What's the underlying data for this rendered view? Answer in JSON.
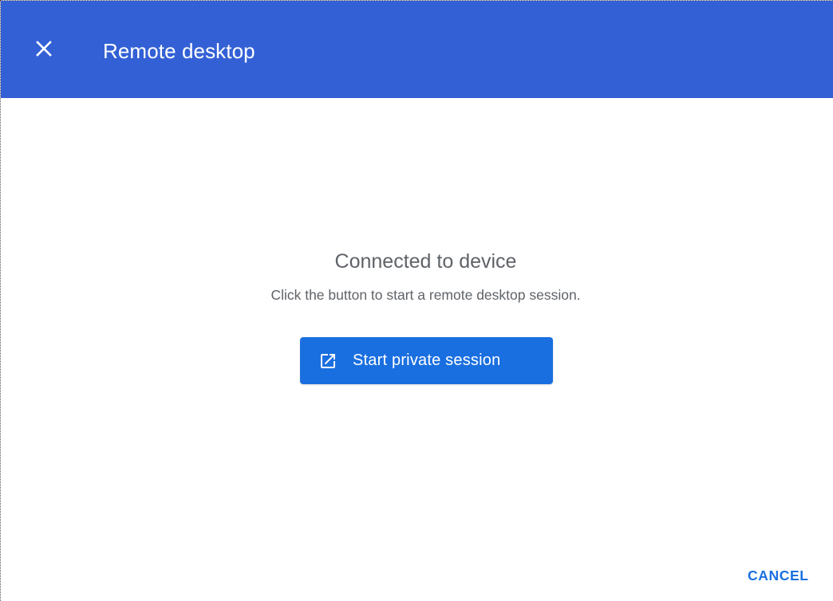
{
  "header": {
    "title": "Remote desktop",
    "close_icon": "close-icon",
    "background_color": "#3360d5"
  },
  "main": {
    "heading": "Connected to device",
    "description": "Click the button to start a remote desktop session.",
    "start_button": {
      "label": "Start private session",
      "icon": "open-in-new-icon",
      "color": "#1a6fe0"
    }
  },
  "footer": {
    "cancel_label": "CANCEL"
  }
}
